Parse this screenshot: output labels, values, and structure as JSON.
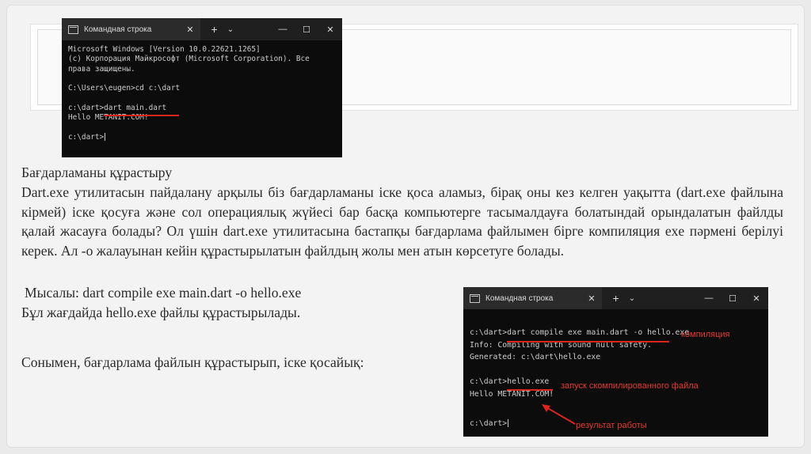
{
  "terminal1": {
    "tab_title": "Командная строка",
    "lines": [
      "Microsoft Windows [Version 10.0.22621.1265]",
      "(c) Корпорация Майкрософт (Microsoft Corporation). Все",
      "права защищены.",
      "",
      "C:\\Users\\eugen>cd c:\\dart",
      "",
      "c:\\dart>dart main.dart",
      "Hello METANIT.COM!",
      "",
      "c:\\dart>"
    ]
  },
  "heading": "Бағдарламаны құрастыру",
  "paragraph": "Dart.exe утилитасын пайдалану арқылы біз бағдарламаны іске қоса аламыз, бірақ оны кез келген уақытта (dart.exe файлына кірмей) іске қосуға және сол операциялық жүйесі бар басқа компьютерге тасымалдауға болатындай орындалатын файлды қалай жасауға болады? Ол үшін dart.exe утилитасына бастапқы бағдарлама файлымен бірге компиляция exe пәрмені берілуі керек. Ал -о жалауынан кейін құрастырылатын файлдың жолы мен атын көрсетуге болады.",
  "example": "Мысалы: dart compile exe main.dart -o hello.exe",
  "result": "Бұл жағдайда hello.exe файлы құрастырылады.",
  "closing": "Сонымен, бағдарлама файлын құрастырып, іске қосайық:",
  "terminal2": {
    "tab_title": "Командная строка",
    "lines": [
      "c:\\dart>dart compile exe main.dart -o hello.exe",
      "Info: Compiling with sound null safety.",
      "Generated: c:\\dart\\hello.exe",
      "",
      "c:\\dart>hello.exe",
      "Hello METANIT.COM!",
      "",
      "c:\\dart>"
    ],
    "annotations": {
      "compile": "компиляция",
      "launch": "запуск скомпилированного файла",
      "output": "результат работы"
    },
    "annotation_color": "#e53a2e"
  }
}
